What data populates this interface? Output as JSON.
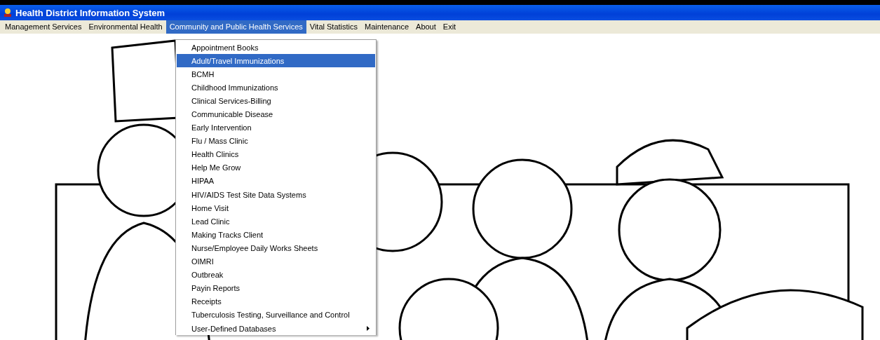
{
  "window": {
    "title": "Health District Information System"
  },
  "menu_bar": [
    {
      "label": "Management Services",
      "selected": false
    },
    {
      "label": "Environmental Health",
      "selected": false
    },
    {
      "label": "Community and Public Health Services",
      "selected": true
    },
    {
      "label": "Vital Statistics",
      "selected": false
    },
    {
      "label": "Maintenance",
      "selected": false
    },
    {
      "label": "About",
      "selected": false
    },
    {
      "label": "Exit",
      "selected": false
    }
  ],
  "dropdown": {
    "items": [
      {
        "label": "Appointment Books",
        "selected": false,
        "has_submenu": false
      },
      {
        "label": "Adult/Travel Immunizations",
        "selected": true,
        "has_submenu": false
      },
      {
        "label": "BCMH",
        "selected": false,
        "has_submenu": false
      },
      {
        "label": "Childhood Immunizations",
        "selected": false,
        "has_submenu": false
      },
      {
        "label": "Clinical Services-Billing",
        "selected": false,
        "has_submenu": false
      },
      {
        "label": "Communicable Disease",
        "selected": false,
        "has_submenu": false
      },
      {
        "label": "Early Intervention",
        "selected": false,
        "has_submenu": false
      },
      {
        "label": "Flu / Mass Clinic",
        "selected": false,
        "has_submenu": false
      },
      {
        "label": "Health Clinics",
        "selected": false,
        "has_submenu": false
      },
      {
        "label": "Help Me Grow",
        "selected": false,
        "has_submenu": false
      },
      {
        "label": "HIPAA",
        "selected": false,
        "has_submenu": false
      },
      {
        "label": "HIV/AIDS Test Site Data Systems",
        "selected": false,
        "has_submenu": false
      },
      {
        "label": "Home Visit",
        "selected": false,
        "has_submenu": false
      },
      {
        "label": "Lead Clinic",
        "selected": false,
        "has_submenu": false
      },
      {
        "label": "Making Tracks Client",
        "selected": false,
        "has_submenu": false
      },
      {
        "label": "Nurse/Employee Daily Works Sheets",
        "selected": false,
        "has_submenu": false
      },
      {
        "label": "OIMRI",
        "selected": false,
        "has_submenu": false
      },
      {
        "label": "Outbreak",
        "selected": false,
        "has_submenu": false
      },
      {
        "label": "Payin Reports",
        "selected": false,
        "has_submenu": false
      },
      {
        "label": "Receipts",
        "selected": false,
        "has_submenu": false
      },
      {
        "label": "Tuberculosis Testing, Surveillance and Control",
        "selected": false,
        "has_submenu": false
      },
      {
        "label": "User-Defined Databases",
        "selected": false,
        "has_submenu": true
      }
    ]
  }
}
